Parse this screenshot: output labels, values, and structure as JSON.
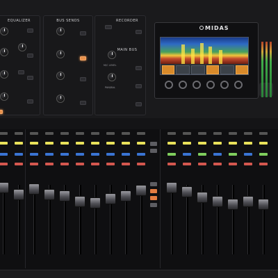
{
  "sections": {
    "equalizer": "EQUALIZER",
    "bus_sends": "BUS SENDS",
    "recorder": "RECORDER",
    "main_bus": "MAIN BUS",
    "main_bus_knob1": "M/C LEVEL",
    "main_bus_knob2": "PAN/BAL"
  },
  "brand": "MIDAS",
  "colors": {
    "orange": "#e8914c",
    "yellow": "#e9e25a",
    "green": "#7fce5d",
    "blue": "#3a74d3",
    "red": "#d4574f"
  }
}
